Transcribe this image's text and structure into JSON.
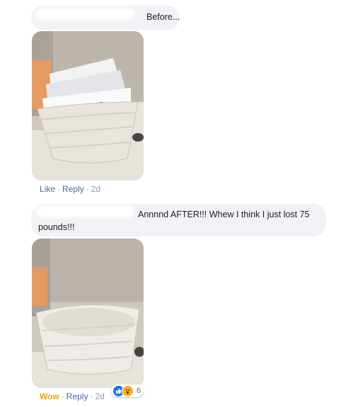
{
  "comment1": {
    "text": "Before..."
  },
  "comment1_actions": {
    "like": "Like",
    "reply": "Reply",
    "time": "2d"
  },
  "comment2": {
    "text_line1": "Annnnd AFTER!!! Whew I think I just lost 75",
    "text_line2": "pounds!!!"
  },
  "comment2_actions": {
    "reaction": "Wow",
    "reply": "Reply",
    "time": "2d",
    "reaction_count": "6"
  },
  "reaction_icons": [
    "like-icon",
    "wow-icon"
  ],
  "colors": {
    "link": "#4b66a0",
    "wow": "#e8a317",
    "bubble": "#f0f2f5",
    "meta": "#8d949e"
  }
}
